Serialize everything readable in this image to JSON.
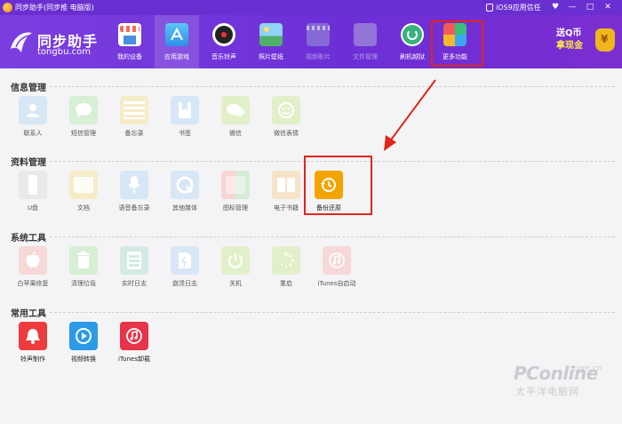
{
  "window": {
    "title": "同步助手(同步推 电脑版)",
    "trust_label": "iOS9应用信任",
    "controls": [
      "♥",
      "—",
      "□",
      "✕"
    ]
  },
  "logo": {
    "name": "同步助手",
    "site": "tongbu.com"
  },
  "nav": [
    {
      "label": "我的设备",
      "icon": "store-icon",
      "color": "#f36b5c"
    },
    {
      "label": "应用游戏",
      "icon": "app-store-icon",
      "color": "#3aa8f0"
    },
    {
      "label": "音乐铃声",
      "icon": "music-disc-icon",
      "color": "#2d2d2d"
    },
    {
      "label": "照片壁纸",
      "icon": "photo-icon",
      "color": "#4fb06a"
    },
    {
      "label": "视频影片",
      "icon": "clapper-icon",
      "color": "#8b72d6"
    },
    {
      "label": "文件管理",
      "icon": "folder-icon",
      "color": "#9a80d8"
    },
    {
      "label": "刷机越狱",
      "icon": "refresh-icon",
      "color": "#38b27d"
    },
    {
      "label": "更多功能",
      "icon": "more-grid-icon",
      "color": "#f4b400"
    }
  ],
  "promo": {
    "line1": "送Q币",
    "line2": "拿现金"
  },
  "sections": [
    {
      "title": "信息管理",
      "items": [
        {
          "label": "联系人",
          "icon": "contact-icon"
        },
        {
          "label": "短信管理",
          "icon": "sms-icon"
        },
        {
          "label": "备忘录",
          "icon": "memo-icon"
        },
        {
          "label": "书签",
          "icon": "bookmark-icon"
        },
        {
          "label": "微信",
          "icon": "wechat-icon"
        },
        {
          "label": "微信表情",
          "icon": "emoji-icon"
        }
      ]
    },
    {
      "title": "资料管理",
      "items": [
        {
          "label": "U盘",
          "icon": "usb-icon"
        },
        {
          "label": "文档",
          "icon": "document-icon"
        },
        {
          "label": "语音备忘录",
          "icon": "mic-icon"
        },
        {
          "label": "其他媒体",
          "icon": "media-icon"
        },
        {
          "label": "图标管理",
          "icon": "icon-manage-icon"
        },
        {
          "label": "电子书籍",
          "icon": "ebook-icon"
        },
        {
          "label": "备份还原",
          "icon": "backup-restore-icon"
        }
      ]
    },
    {
      "title": "系统工具",
      "items": [
        {
          "label": "白苹果修复",
          "icon": "apple-repair-icon"
        },
        {
          "label": "清理垃圾",
          "icon": "trash-icon"
        },
        {
          "label": "实时日志",
          "icon": "log-icon"
        },
        {
          "label": "崩溃日志",
          "icon": "crash-log-icon"
        },
        {
          "label": "关机",
          "icon": "power-icon"
        },
        {
          "label": "重启",
          "icon": "restart-icon"
        },
        {
          "label": "iTunes自启动",
          "icon": "itunes-autostart-icon"
        }
      ]
    },
    {
      "title": "常用工具",
      "items": [
        {
          "label": "铃声制作",
          "icon": "ringtone-icon"
        },
        {
          "label": "视频转换",
          "icon": "video-convert-icon"
        },
        {
          "label": "iTunes卸载",
          "icon": "itunes-uninstall-icon"
        }
      ]
    }
  ],
  "watermark": {
    "brand": "PConline",
    "domain": ".com.cn",
    "cn": "太平洋电脑网"
  }
}
